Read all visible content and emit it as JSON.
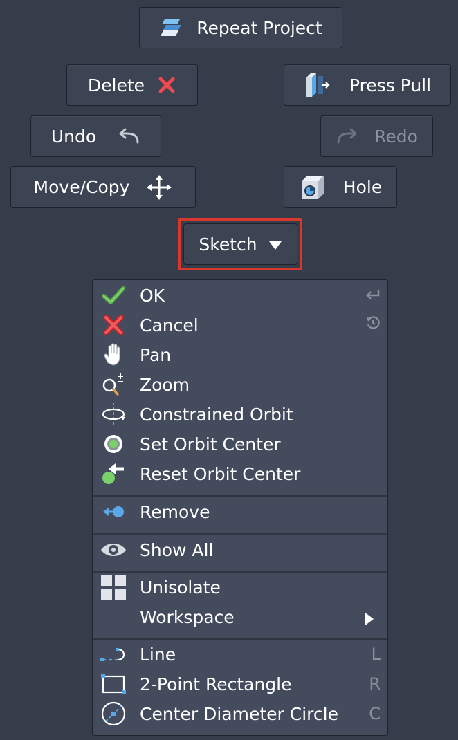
{
  "buttons": {
    "repeat_project": "Repeat Project",
    "delete": "Delete",
    "press_pull": "Press Pull",
    "undo": "Undo",
    "redo": "Redo",
    "move_copy": "Move/Copy",
    "hole": "Hole"
  },
  "sketch": {
    "label": "Sketch"
  },
  "menu": {
    "items": [
      {
        "label": "OK",
        "icon": "checkmark-icon",
        "shortcut_icon": "enter-key-icon"
      },
      {
        "label": "Cancel",
        "icon": "red-x-icon",
        "shortcut_icon": "escape-undo-icon"
      },
      {
        "label": "Pan",
        "icon": "hand-icon"
      },
      {
        "label": "Zoom",
        "icon": "zoom-icon"
      },
      {
        "label": "Constrained Orbit",
        "icon": "constrained-orbit-icon"
      },
      {
        "label": "Set Orbit Center",
        "icon": "orbit-center-icon"
      },
      {
        "label": "Reset Orbit Center",
        "icon": "reset-orbit-center-icon"
      },
      {
        "label": "Remove",
        "icon": "remove-icon"
      },
      {
        "label": "Show All",
        "icon": "eye-icon"
      },
      {
        "label": "Unisolate",
        "icon": "grid-icon"
      },
      {
        "label": "Workspace",
        "icon": "",
        "submenu": true
      },
      {
        "label": "Line",
        "icon": "line-icon",
        "shortcut": "L"
      },
      {
        "label": "2-Point Rectangle",
        "icon": "rectangle-icon",
        "shortcut": "R"
      },
      {
        "label": "Center Diameter Circle",
        "icon": "circle-icon",
        "shortcut": "C"
      }
    ]
  },
  "colors": {
    "background": "#353c4a",
    "button": "#3c4454",
    "menu": "#434b5c",
    "highlight": "#d9372b",
    "accent_blue": "#5aa9e6"
  }
}
